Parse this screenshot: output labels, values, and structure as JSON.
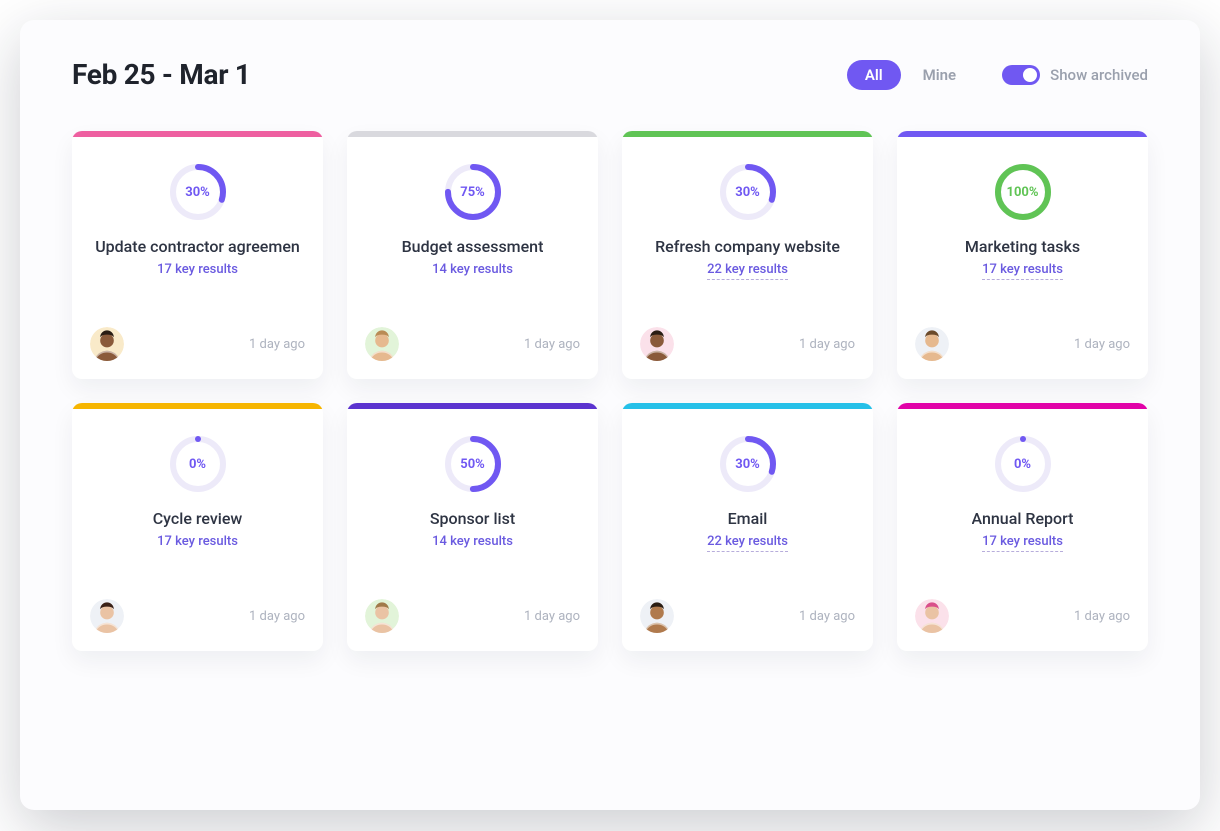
{
  "header": {
    "date_range": "Feb 25 - Mar 1",
    "filter_all": "All",
    "filter_mine": "Mine",
    "toggle_label": "Show archived"
  },
  "colors": {
    "accent_purple": "#7058f2",
    "green": "#60c455",
    "pink": "#ee2a7b",
    "orange": "#f6b500",
    "cyan": "#25c0e8",
    "magenta": "#e102a8",
    "grey": "#d9d9de",
    "deep_purple": "#5b33cf"
  },
  "cards": [
    {
      "stripe": "#ee5fa0",
      "progress": 30,
      "progress_label": "30%",
      "ring_color": "#7058f2",
      "label_color": "#7058f2",
      "title": "Update contractor agreemen",
      "sub": "17 key results",
      "underline": false,
      "timestamp": "1 day ago",
      "avatar_bg": "#f9eac9",
      "avatar_skin": "#8a5a3a",
      "avatar_hair": "#2a1d14"
    },
    {
      "stripe": "#d9d9de",
      "progress": 75,
      "progress_label": "75%",
      "ring_color": "#7058f2",
      "label_color": "#7058f2",
      "title": "Budget assessment",
      "sub": "14 key results",
      "underline": false,
      "timestamp": "1 day ago",
      "avatar_bg": "#e2f4d9",
      "avatar_skin": "#e6b98f",
      "avatar_hair": "#b98b55"
    },
    {
      "stripe": "#60c455",
      "progress": 30,
      "progress_label": "30%",
      "ring_color": "#7058f2",
      "label_color": "#7058f2",
      "title": "Refresh company website",
      "sub": "22 key results",
      "underline": true,
      "timestamp": "1 day ago",
      "avatar_bg": "#fbe1ea",
      "avatar_skin": "#8a5a3a",
      "avatar_hair": "#2a1d14"
    },
    {
      "stripe": "#7058f2",
      "progress": 100,
      "progress_label": "100%",
      "ring_color": "#60c455",
      "label_color": "#60c455",
      "title": "Marketing tasks",
      "sub": "17 key results",
      "underline": true,
      "timestamp": "1 day ago",
      "avatar_bg": "#eef1f6",
      "avatar_skin": "#e6b98f",
      "avatar_hair": "#6b4a2b"
    },
    {
      "stripe": "#f6b500",
      "progress": 0,
      "progress_label": "0%",
      "ring_color": "#7058f2",
      "label_color": "#7058f2",
      "title": "Cycle review",
      "sub": "17 key results",
      "underline": false,
      "timestamp": "1 day ago",
      "avatar_bg": "#eef1f6",
      "avatar_skin": "#eac3a4",
      "avatar_hair": "#3a2118"
    },
    {
      "stripe": "#5b33cf",
      "progress": 50,
      "progress_label": "50%",
      "ring_color": "#7058f2",
      "label_color": "#7058f2",
      "title": "Sponsor list",
      "sub": "14 key results",
      "underline": false,
      "timestamp": "1 day ago",
      "avatar_bg": "#e2f4d9",
      "avatar_skin": "#eac3a4",
      "avatar_hair": "#a07a4a"
    },
    {
      "stripe": "#25c0e8",
      "progress": 30,
      "progress_label": "30%",
      "ring_color": "#7058f2",
      "label_color": "#7058f2",
      "title": "Email",
      "sub": "22 key results",
      "underline": true,
      "timestamp": "1 day ago",
      "avatar_bg": "#eef1f6",
      "avatar_skin": "#b07a4d",
      "avatar_hair": "#2a1d14"
    },
    {
      "stripe": "#e102a8",
      "progress": 0,
      "progress_label": "0%",
      "ring_color": "#7058f2",
      "label_color": "#7058f2",
      "title": "Annual Report",
      "sub": "17 key results",
      "underline": true,
      "timestamp": "1 day ago",
      "avatar_bg": "#fbe1ea",
      "avatar_skin": "#eac3a4",
      "avatar_hair": "#d94f8a"
    }
  ]
}
